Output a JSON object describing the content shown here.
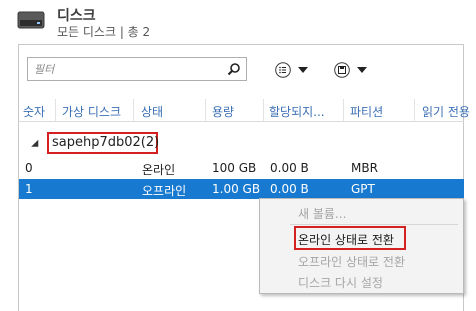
{
  "header": {
    "title": "디스크",
    "subtitle": "모든 디스크 | 총 2",
    "icon": "disk-drive-icon"
  },
  "toolbar": {
    "filter_placeholder": "필터",
    "search_icon": "search-icon",
    "view_icon": "list-view-icon",
    "save_icon": "save-icon"
  },
  "columns": [
    "숫자",
    "가상 디스크",
    "상태",
    "용량",
    "할당되지...",
    "파티션",
    "읽기 전용"
  ],
  "group": {
    "label": "sapehp7db02(2)"
  },
  "rows": [
    {
      "number": "0",
      "virtual_disk": "",
      "status": "온라인",
      "capacity": "100 GB",
      "unallocated": "0.00 B",
      "partition": "MBR",
      "read_only": ""
    },
    {
      "number": "1",
      "virtual_disk": "",
      "status": "오프라인",
      "capacity": "1.00 GB",
      "unallocated": "0.00 B",
      "partition": "GPT",
      "read_only": ""
    }
  ],
  "selected_row": 1,
  "context_menu": {
    "items": [
      {
        "label": "새 볼륨...",
        "enabled": false
      },
      {
        "label": "온라인 상태로 전환",
        "enabled": true
      },
      {
        "label": "오프라인 상태로 전환",
        "enabled": false
      },
      {
        "label": "디스크 다시 설정",
        "enabled": false
      }
    ]
  },
  "colors": {
    "selection": "#1779cf",
    "highlight_box": "#d42020",
    "header_text": "#3b6fb6"
  }
}
